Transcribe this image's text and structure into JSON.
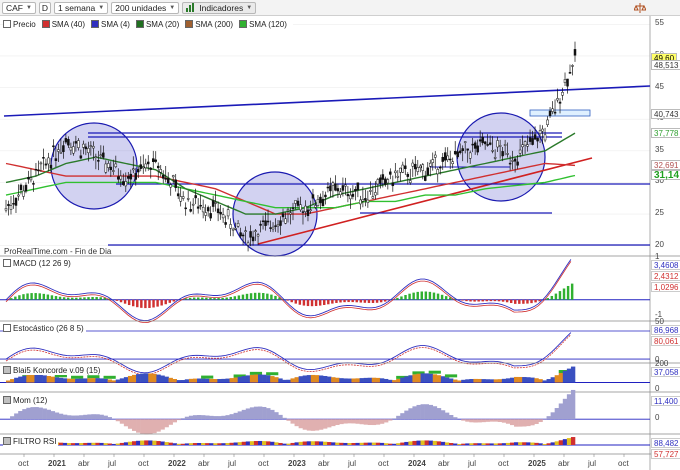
{
  "toolbar": {
    "ticker": "CAF",
    "mode_button": "D",
    "period": "1 semana",
    "units": "200 unidades",
    "indicators": "Indicadores"
  },
  "legend": [
    {
      "label": "Precio",
      "color": "#ffffff"
    },
    {
      "label": "SMA (40)",
      "color": "#d03030"
    },
    {
      "label": "SMA (4)",
      "color": "#3030c0"
    },
    {
      "label": "SMA (20)",
      "color": "#207020"
    },
    {
      "label": "SMA (200)",
      "color": "#a06030"
    },
    {
      "label": "SMA (120)",
      "color": "#30b030"
    }
  ],
  "watermark": "ProRealTime.com - Fin de Dia",
  "price_axis": {
    "ticks": [
      "55",
      "50",
      "45",
      "40",
      "35",
      "30",
      "25",
      "20"
    ],
    "tags": [
      {
        "text": "49,60",
        "bg": "#ffff66",
        "color": "#000000"
      },
      {
        "text": "48,513",
        "bg": "#ffffff",
        "color": "#333333"
      },
      {
        "text": "40,743",
        "bg": "#ffffff",
        "color": "#333333"
      },
      {
        "text": "37,778",
        "bg": "#ffffff",
        "color": "#30a030"
      },
      {
        "text": "32,691",
        "bg": "#ffffff",
        "color": "#b05050"
      },
      {
        "text": "31,14",
        "bg": "#ffffff",
        "color": "#20a020"
      }
    ]
  },
  "panels": {
    "macd": {
      "label": "MACD (12 26 9)",
      "ticks": [
        "1",
        "0",
        "-1"
      ],
      "tags": [
        "3,4608",
        "2,4312",
        "1,0296"
      ]
    },
    "stoch": {
      "label": "Estocástico (26 8 5)",
      "ticks": [
        "50",
        "0"
      ],
      "tags": [
        "86,968",
        "80,061"
      ]
    },
    "blai5": {
      "label": "Blai5 Koncorde v.09 (15)",
      "ticks": [
        "200",
        "0"
      ],
      "tags": [
        "37,058"
      ]
    },
    "mom": {
      "label": "Mom (12)",
      "ticks": [
        "0"
      ],
      "tags": [
        "11,400"
      ]
    },
    "rsi": {
      "label": "FILTRO RSI",
      "ticks": [],
      "tags": [
        "88,482",
        "57,727"
      ]
    }
  },
  "time_axis": [
    "oct",
    "2021",
    "abr",
    "jul",
    "oct",
    "2022",
    "abr",
    "jul",
    "oct",
    "2023",
    "abr",
    "jul",
    "oct",
    "2024",
    "abr",
    "jul",
    "oct",
    "2025",
    "abr",
    "jul",
    "oct"
  ],
  "chart_data": {
    "type": "line",
    "title": "",
    "xlabel": "",
    "ylabel": "",
    "ylim": [
      19,
      56
    ],
    "x": [
      "2020-10",
      "2021-01",
      "2021-04",
      "2021-07",
      "2021-10",
      "2022-01",
      "2022-04",
      "2022-07",
      "2022-10",
      "2023-01",
      "2023-04",
      "2023-07",
      "2023-10",
      "2024-01",
      "2024-04",
      "2024-07",
      "2024-10",
      "2025-01",
      "2025-04",
      "2025-06"
    ],
    "series": [
      {
        "name": "Precio",
        "values": [
          26,
          31,
          37,
          34,
          31,
          33,
          27,
          26,
          21,
          24,
          26,
          29,
          28,
          31,
          32,
          34,
          36,
          34,
          38,
          49.6
        ]
      },
      {
        "name": "SMA (40)",
        "values": [
          33,
          32,
          31,
          31,
          31,
          31,
          30,
          29,
          27,
          25,
          25,
          26,
          27,
          28,
          29,
          30,
          31,
          32,
          33,
          32.7
        ]
      },
      {
        "name": "SMA (120)",
        "values": [
          28,
          29,
          30,
          30,
          30,
          30,
          29,
          28,
          27,
          26,
          26,
          26,
          27,
          27,
          28,
          28,
          29,
          29.5,
          30,
          31.1
        ]
      },
      {
        "name": "SMA (20)",
        "values": [
          30,
          31,
          33,
          34,
          33,
          32,
          29,
          27,
          25,
          25,
          26,
          28,
          29,
          30,
          31,
          32,
          33,
          34,
          35,
          37.8
        ]
      }
    ]
  }
}
